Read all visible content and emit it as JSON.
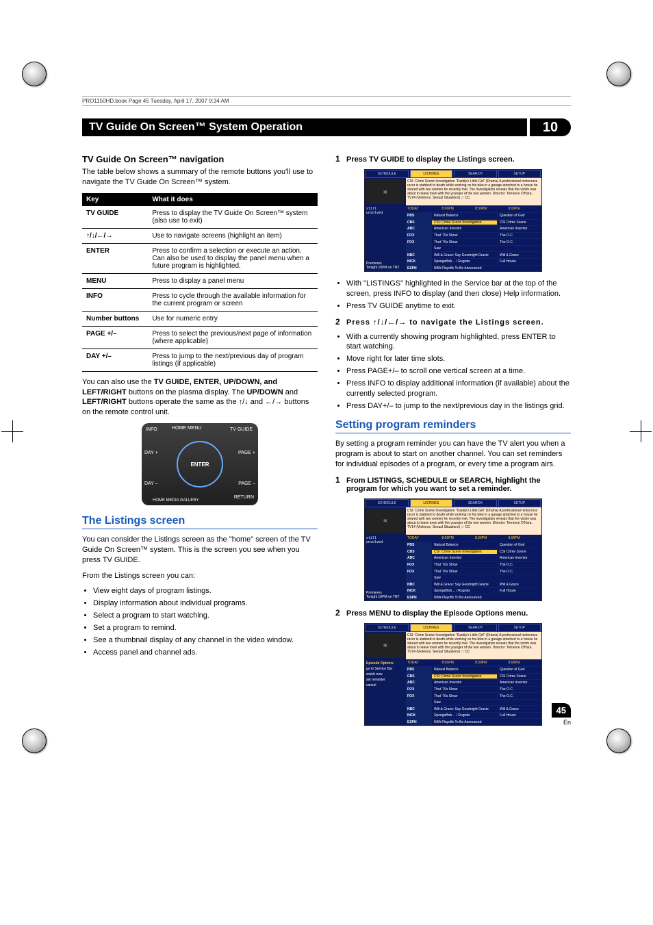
{
  "headerLine": "PRO1150HD.book  Page 45  Tuesday, April 17, 2007  9:34 AM",
  "titleBar": "TV Guide On Screen™ System Operation",
  "chapterNumber": "10",
  "left": {
    "navHeading": "TV Guide On Screen™ navigation",
    "navIntro": "The table below shows a summary of the remote buttons you'll use to navigate the TV Guide On Screen™ system.",
    "table": {
      "headKey": "Key",
      "headWhat": "What it does",
      "rows": [
        {
          "key": "TV GUIDE",
          "desc": "Press to display the TV Guide On Screen™ system (also use to exit)"
        },
        {
          "key": "↑/↓/←/→",
          "desc": "Use to navigate screens (highlight an item)"
        },
        {
          "key": "ENTER",
          "desc": "Press to confirm a selection or execute an action. Can also be used to display the panel menu when a future program is highlighted."
        },
        {
          "key": "MENU",
          "desc": "Press to display a panel menu"
        },
        {
          "key": "INFO",
          "desc": "Press to cycle through the available information for the current program or screen"
        },
        {
          "key": "Number buttons",
          "desc": "Use for numeric entry"
        },
        {
          "key": "PAGE +/–",
          "desc": "Press to select the previous/next page of information (where applicable)"
        },
        {
          "key": "DAY +/–",
          "desc": "Press to jump to the next/previous day of program listings (if applicable)"
        }
      ]
    },
    "afterTable1": "You can also use the ",
    "afterTableKeys": "TV GUIDE, ENTER, UP/DOWN, and LEFT/RIGHT",
    "afterTable2": " buttons on the plasma display. The ",
    "afterTableKeys2": "UP/DOWN",
    "afterTable3": " and ",
    "afterTableKeys3": "LEFT/RIGHT",
    "afterTable4": " buttons operate the same as the ↑/↓ and ←/→ buttons on the remote control unit.",
    "remote": {
      "labels": [
        "INFO",
        "HOME MENU",
        "TV GUIDE",
        "ENTER",
        "DAY +",
        "DAY –",
        "PAGE +",
        "PAGE –",
        "RETURN",
        "HOME MEDIA GALLERY"
      ]
    },
    "listingsHeading": "The Listings screen",
    "listingsIntro": "You can consider the Listings screen as the \"home\" screen of the TV Guide On Screen™ system. This is the screen you see when you press TV GUIDE.",
    "listingsFrom": "From the Listings screen you can:",
    "listingsBullets": [
      "View eight days of program listings.",
      "Display information about individual programs.",
      "Select a program to start watching.",
      "Set a program to remind.",
      "See a thumbnail display of any channel in the video window.",
      "Access panel and channel ads."
    ]
  },
  "right": {
    "step1": {
      "num": "1",
      "title": "Press TV GUIDE to display the Listings screen.",
      "bullets": [
        "With \"LISTINGS\" highlighted in the Service bar at the top of the screen, press INFO to display (and then close) Help information.",
        "Press TV GUIDE anytime to exit."
      ]
    },
    "step2": {
      "num": "2",
      "title": "Press ↑/↓/←/→ to navigate the Listings screen.",
      "bullets": [
        "With a currently showing program highlighted, press ENTER to start watching.",
        "Move right for later time slots.",
        "Press PAGE+/– to scroll one vertical screen at a time.",
        "Press INFO to display additional information (if available) about the currently selected program.",
        "Press DAY+/– to jump to the next/previous day in the listings grid."
      ]
    },
    "remindersHeading": "Setting program reminders",
    "remindersIntro": "By setting a program reminder you can have the TV alert you when a program is about to start on another channel. You can set reminders for individual episodes of a program, or every time a program airs.",
    "step1b": {
      "num": "1",
      "title": "From LISTINGS, SCHEDULE or SEARCH, highlight the program for which you want to set a reminder."
    },
    "step2b": {
      "num": "2",
      "title": "Press MENU to display the Episode Options menu."
    }
  },
  "guideShot": {
    "tabs": [
      "SCHEDULE",
      "LISTINGS",
      "SEARCH",
      "SETUP"
    ],
    "desc": "CSI: Crime Scene Investigation \"Daddy's Little Girl\" (Drama) A professional motocross racer is stabbed to death while working on his bike in a garage attached to a house he shared with two women he recently met. The investigation reveals that the victim was about to leave town with the younger of the two women. Director: Terrence O'Hara. TV14 (Violence, Sexual Situations) ☆ CC",
    "times": [
      "TODAY",
      "8:00PM",
      "8:30PM",
      "9:00PM"
    ],
    "leftPromo": "Premieres\nTonight 10PM on TNT",
    "leftPane": "still\nunsolved",
    "rows": [
      {
        "ch": "PBS",
        "p1": "Natural Balance",
        "p2": "Question of God"
      },
      {
        "ch": "CBS",
        "p1": "CSI: Crime Scene Investigation",
        "p2": "CSI Crime Scene",
        "hl": true
      },
      {
        "ch": "ABC",
        "p1": "American Inventor",
        "p2": "American Inventor"
      },
      {
        "ch": "FOX",
        "p1": "That '70s Show",
        "p2": "The O.C."
      },
      {
        "ch": "FOX",
        "p1": "That '70s Show",
        "p2": "The O.C."
      },
      {
        "ch": "",
        "p1": "Saw",
        "p2": ""
      },
      {
        "ch": "NBC",
        "p1": "Will & Grace: Say Goodnight Gracie",
        "p2": "Will & Grace"
      },
      {
        "ch": "NICK",
        "p1": "SpongeBob… / Rugrats",
        "p2": "Full House"
      },
      {
        "ch": "ESPN",
        "p1": "NBA Playoffs To Be Announced",
        "p2": ""
      }
    ]
  },
  "guideShot3": {
    "options": [
      "Episode Options",
      "go to Service Bar",
      "watch now",
      "set reminder",
      "cancel"
    ]
  },
  "footer": {
    "page": "45",
    "lang": "En"
  }
}
